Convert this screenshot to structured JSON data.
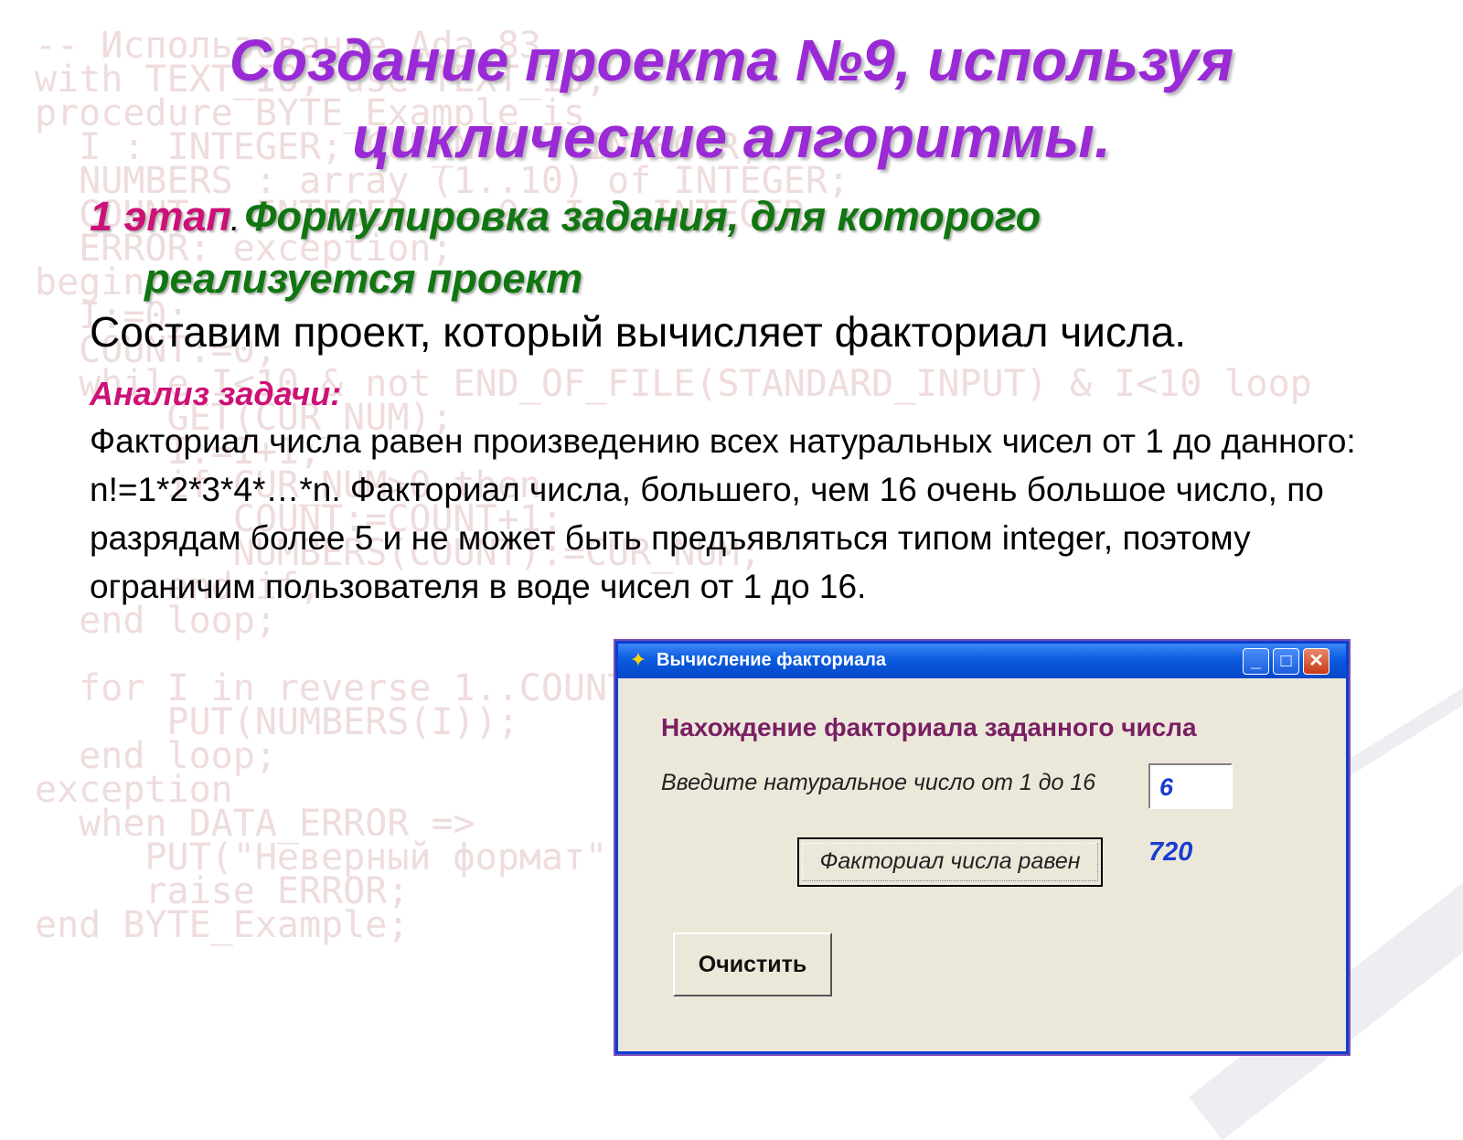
{
  "slide": {
    "title": "Создание проекта №9, используя циклические алгоритмы.",
    "stage_number": "1 этап",
    "stage_title_line1": "Формулировка задания, для которого",
    "stage_title_line2": "реализуется проект",
    "task_statement": "Составим проект, который вычисляет факториал числа.",
    "analysis_heading": "Анализ задачи:",
    "analysis_text": "Факториал числа равен произведению всех натуральных чисел от 1 до данного: n!=1*2*3*4*…*n. Факториал числа, большего, чем 16 очень большое число, по разрядам более 5 и не может быть предъявляться типом integer, поэтому ограничим пользователя в воде чисел от 1 до 16."
  },
  "background_code": [
    "-- Использование Ada 83",
    "with TEXT_IO; use TEXT_IO;",
    "procedure BYTE_Example is",
    "  I : INTEGER; CUR_NUM : INTEGER;",
    "  NUMBERS : array (1..10) of INTEGER;",
    "  COUNT : INTEGER := 0; I : INTEGER;",
    "  ERROR: exception;",
    "begin",
    "  I:=0;",
    "  COUNT:=0;",
    "  while I<10 & not END_OF_FILE(STANDARD_INPUT) & I<10 loop",
    "      GET(CUR_NUM);",
    "      I:=I+1;",
    "      if CUR_NUM>0 then",
    "         COUNT:=COUNT+1;",
    "         NUMBERS(COUNT):=CUR_NUM;",
    "      end if;",
    "  end loop;",
    "",
    "  for I in reverse 1..COUNT loop",
    "      PUT(NUMBERS(I));",
    "  end loop;",
    "exception",
    "  when DATA_ERROR =>",
    "     PUT(\"Неверный формат\");",
    "     raise ERROR;",
    "end BYTE_Example;"
  ],
  "window": {
    "title": "Вычисление факториала",
    "heading": "Нахождение факториала заданного числа",
    "input_label": "Введите натуральное число от 1 до 16",
    "input_value": "6",
    "factorial_button_label": "Факториал числа равен",
    "result_value": "720",
    "clear_button_label": "Очистить",
    "minimize_glyph": "_",
    "maximize_glyph": "□",
    "close_glyph": "✕",
    "icon_glyph": "✦"
  }
}
